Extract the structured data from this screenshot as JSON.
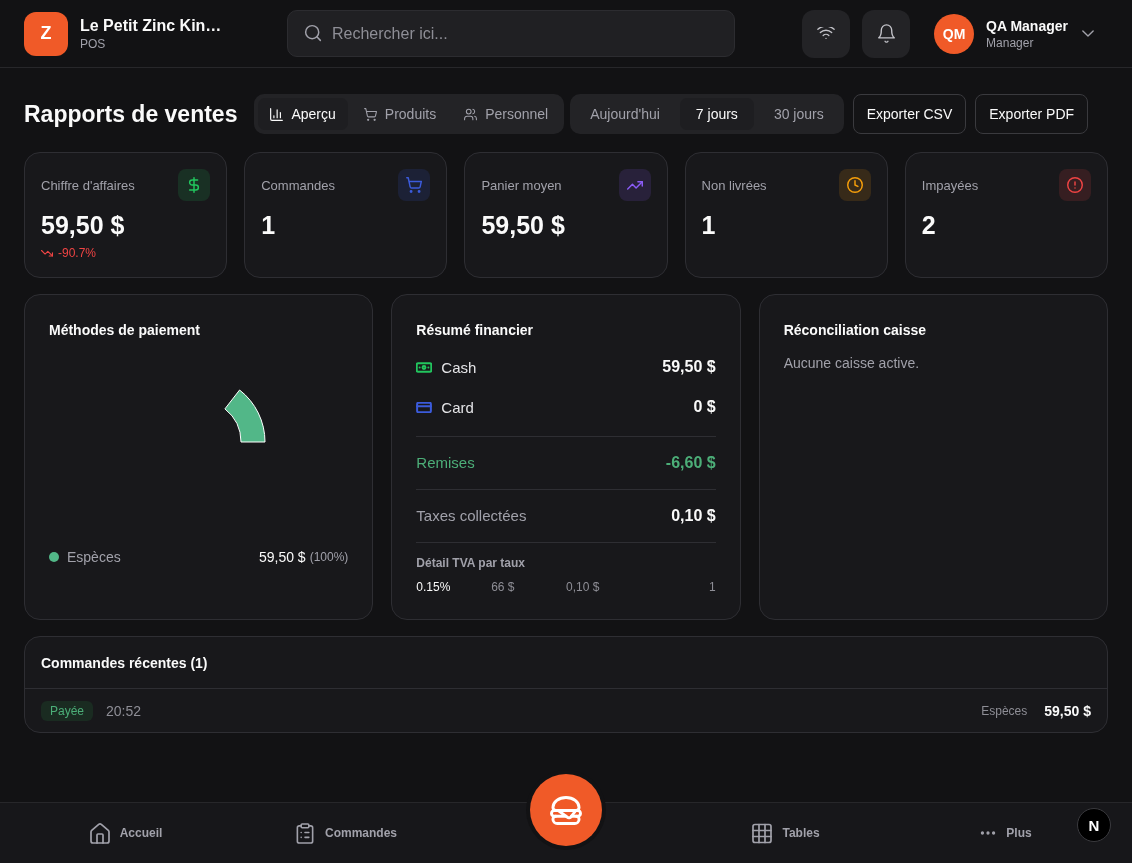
{
  "header": {
    "logo": "Z",
    "restaurant_name": "Le Petit Zinc Kin…",
    "subtitle": "POS",
    "search": {
      "placeholder": "Rechercher ici..."
    },
    "user": {
      "initials": "QM",
      "name": "QA Manager",
      "role": "Manager"
    }
  },
  "page_title": "Rapports de ventes",
  "view_tabs": [
    {
      "kind": "overview",
      "label": "Aperçu",
      "selected": true
    },
    {
      "kind": "products",
      "label": "Produits",
      "selected": false
    },
    {
      "kind": "staff",
      "label": "Personnel",
      "selected": false
    }
  ],
  "period_tabs": [
    {
      "label": "Aujourd'hui",
      "selected": false
    },
    {
      "label": "7 jours",
      "selected": true
    },
    {
      "label": "30 jours",
      "selected": false
    }
  ],
  "export_buttons": [
    "Exporter CSV",
    "Exporter PDF"
  ],
  "kpi_cards": [
    {
      "kind": "revenue",
      "label": "Chiffre d'affaires",
      "value": "59,50 $",
      "color": "#22c55e",
      "change": {
        "text": "-90.7%",
        "negative": true
      }
    },
    {
      "kind": "orders",
      "label": "Commandes",
      "value": "1",
      "color": "#3b5bdb"
    },
    {
      "kind": "average",
      "label": "Panier moyen",
      "value": "59,50 $",
      "color": "#8b5cf6"
    },
    {
      "kind": "undelivered",
      "label": "Non livrées",
      "value": "1",
      "color": "#f59e0b"
    },
    {
      "kind": "unpaid",
      "label": "Impayées",
      "value": "2",
      "color": "#ef4444"
    }
  ],
  "payment_methods": {
    "title": "Méthodes de paiement",
    "legend": [
      {
        "label": "Espèces",
        "amount": "59,50 $",
        "share": "(100%)",
        "color": "#52b788"
      }
    ]
  },
  "financial_summary": {
    "title": "Résumé financier",
    "payments": [
      {
        "kind": "cash",
        "label": "Cash",
        "amount": "59,50 $",
        "color": "#22c55e"
      },
      {
        "kind": "card",
        "label": "Card",
        "amount": "0 $",
        "color": "#3b5bdb"
      }
    ],
    "discounts": {
      "label": "Remises",
      "amount": "-6,60 $"
    },
    "taxes": {
      "label": "Taxes collectées",
      "amount": "0,10 $"
    },
    "vat_breakdown": {
      "title": "Détail TVA par taux",
      "rows": [
        {
          "cells": [
            "0.15%",
            "66 $",
            "0,10 $",
            "1"
          ]
        }
      ]
    }
  },
  "cash_reconciliation": {
    "title": "Réconciliation caisse",
    "message": "Aucune caisse active."
  },
  "recent_orders": {
    "title": "Commandes récentes (1)",
    "orders": [
      {
        "kind": "paid",
        "status": "Payée",
        "time": "20:52",
        "payment_method": "Espèces",
        "total": "59,50 $"
      }
    ]
  },
  "bottom_nav": [
    {
      "kind": "home",
      "label": "Accueil",
      "selected": false
    },
    {
      "kind": "orders",
      "label": "Commandes",
      "selected": false
    },
    {
      "kind": "tables",
      "label": "Tables",
      "selected": false
    },
    {
      "kind": "more",
      "label": "Plus",
      "selected": false
    }
  ],
  "dev_badge": "N"
}
